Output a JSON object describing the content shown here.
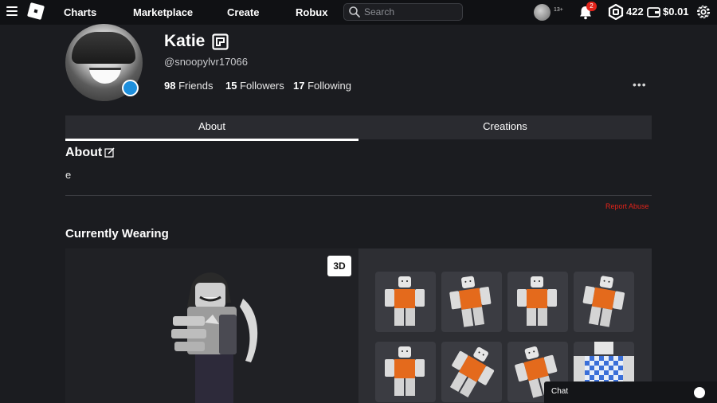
{
  "topbar": {
    "nav": [
      "Charts",
      "Marketplace",
      "Create",
      "Robux"
    ],
    "search_placeholder": "Search",
    "age_badge": "13+",
    "notification_count": "2",
    "robux_balance": "422",
    "wallet_balance": "$0.01"
  },
  "profile": {
    "display_name": "Katie",
    "username": "@snoopylvr17066",
    "friends_count": "98",
    "friends_label": "Friends",
    "followers_count": "15",
    "followers_label": "Followers",
    "following_count": "17",
    "following_label": "Following",
    "more_menu": "•••"
  },
  "tabs": [
    "About",
    "Creations"
  ],
  "about": {
    "title": "About",
    "text": "e",
    "report_abuse": "Report Abuse"
  },
  "wearing": {
    "title": "Currently Wearing",
    "view_mode": "3D",
    "items": [
      {
        "icon": "avatar-pose-item"
      },
      {
        "icon": "avatar-pose-item"
      },
      {
        "icon": "avatar-pose-item"
      },
      {
        "icon": "avatar-pose-item"
      },
      {
        "icon": "avatar-pose-item"
      },
      {
        "icon": "avatar-pose-item"
      },
      {
        "icon": "avatar-pose-item"
      },
      {
        "icon": "checkered-shirt-item"
      }
    ]
  },
  "chat": {
    "label": "Chat"
  },
  "colors": {
    "background": "#1b1c20",
    "topbar": "#101114",
    "accent_blue": "#1e8fdc",
    "danger_red": "#e2231a",
    "shirt_orange": "#e46a1c",
    "checker_blue": "#3a6ed8"
  }
}
